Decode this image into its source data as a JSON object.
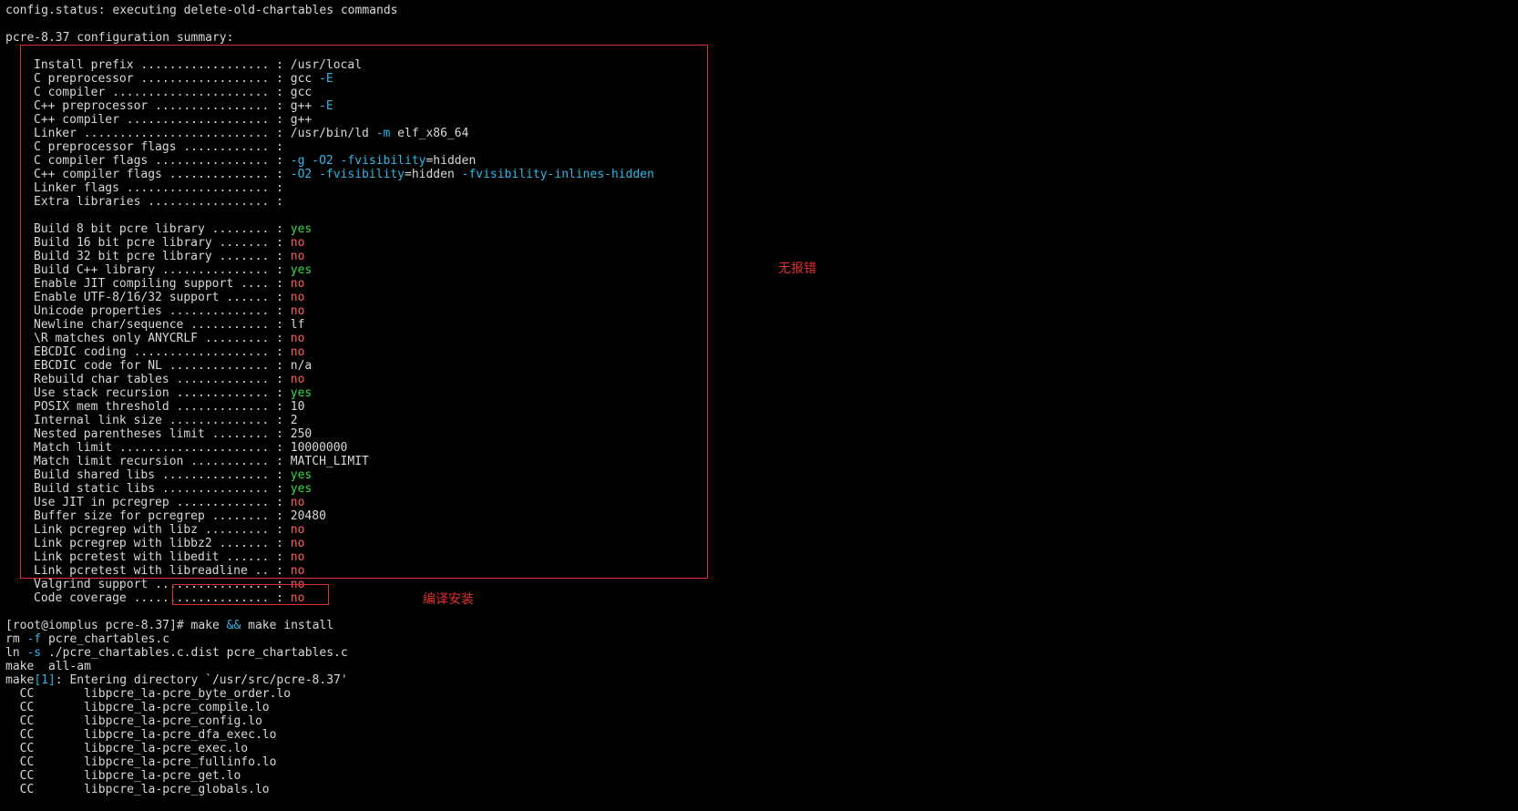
{
  "header": {
    "status_line": "config.status: executing delete-old-chartables commands",
    "summary_title": "pcre-8.37 configuration summary:"
  },
  "config": [
    {
      "label": "Install prefix ..................",
      "value": "/usr/local",
      "tone": "plain"
    },
    {
      "label": "C preprocessor ..................",
      "value": "gcc",
      "flag": "-E",
      "tone": "plain"
    },
    {
      "label": "C compiler ......................",
      "value": "gcc",
      "tone": "plain"
    },
    {
      "label": "C++ preprocessor ................",
      "value": "g++",
      "flag": "-E",
      "tone": "plain"
    },
    {
      "label": "C++ compiler ....................",
      "value": "g++",
      "tone": "plain"
    },
    {
      "label": "Linker ..........................",
      "value": "/usr/bin/ld",
      "flag": "-m",
      "rest": "elf_x86_64",
      "tone": "plain"
    },
    {
      "label": "C preprocessor flags ............",
      "value": "",
      "tone": "plain"
    },
    {
      "label": "C compiler flags ................",
      "value": "",
      "flag": "-g -O2 -fvisibility",
      "rest": "=hidden",
      "tone": "plain"
    },
    {
      "label": "C++ compiler flags ..............",
      "value": "",
      "flag": "-O2 -fvisibility",
      "rest": "=hidden",
      "flag2": "-fvisibility-inlines-hidden",
      "tone": "plain"
    },
    {
      "label": "Linker flags ....................",
      "value": "",
      "tone": "plain"
    },
    {
      "label": "Extra libraries .................",
      "value": "",
      "tone": "plain"
    },
    {
      "label": "",
      "value": "",
      "tone": "blank"
    },
    {
      "label": "Build 8 bit pcre library ........",
      "value": "yes",
      "tone": "green"
    },
    {
      "label": "Build 16 bit pcre library .......",
      "value": "no",
      "tone": "red"
    },
    {
      "label": "Build 32 bit pcre library .......",
      "value": "no",
      "tone": "red"
    },
    {
      "label": "Build C++ library ...............",
      "value": "yes",
      "tone": "green"
    },
    {
      "label": "Enable JIT compiling support ....",
      "value": "no",
      "tone": "red"
    },
    {
      "label": "Enable UTF-8/16/32 support ......",
      "value": "no",
      "tone": "red"
    },
    {
      "label": "Unicode properties ..............",
      "value": "no",
      "tone": "red"
    },
    {
      "label": "Newline char/sequence ...........",
      "value": "lf",
      "tone": "plain"
    },
    {
      "label": "\\R matches only ANYCRLF .........",
      "value": "no",
      "tone": "red"
    },
    {
      "label": "EBCDIC coding ...................",
      "value": "no",
      "tone": "red"
    },
    {
      "label": "EBCDIC code for NL ..............",
      "value": "n/a",
      "tone": "plain"
    },
    {
      "label": "Rebuild char tables .............",
      "value": "no",
      "tone": "red"
    },
    {
      "label": "Use stack recursion .............",
      "value": "yes",
      "tone": "green"
    },
    {
      "label": "POSIX mem threshold .............",
      "value": "10",
      "tone": "plain"
    },
    {
      "label": "Internal link size ..............",
      "value": "2",
      "tone": "plain"
    },
    {
      "label": "Nested parentheses limit ........",
      "value": "250",
      "tone": "plain"
    },
    {
      "label": "Match limit .....................",
      "value": "10000000",
      "tone": "plain"
    },
    {
      "label": "Match limit recursion ...........",
      "value": "MATCH_LIMIT",
      "tone": "plain"
    },
    {
      "label": "Build shared libs ...............",
      "value": "yes",
      "tone": "green"
    },
    {
      "label": "Build static libs ...............",
      "value": "yes",
      "tone": "green"
    },
    {
      "label": "Use JIT in pcregrep .............",
      "value": "no",
      "tone": "red"
    },
    {
      "label": "Buffer size for pcregrep ........",
      "value": "20480",
      "tone": "plain"
    },
    {
      "label": "Link pcregrep with libz .........",
      "value": "no",
      "tone": "red"
    },
    {
      "label": "Link pcregrep with libbz2 .......",
      "value": "no",
      "tone": "red"
    },
    {
      "label": "Link pcretest with libedit ......",
      "value": "no",
      "tone": "red"
    },
    {
      "label": "Link pcretest with libreadline ..",
      "value": "no",
      "tone": "red"
    },
    {
      "label": "Valgrind support ................",
      "value": "no",
      "tone": "red"
    },
    {
      "label": "Code coverage ...................",
      "value": "no",
      "tone": "red"
    }
  ],
  "prompt": {
    "ps1": "[root@iomplus pcre-8.37]#",
    "cmd_a": "make",
    "op": "&&",
    "cmd_b": "make install"
  },
  "output": {
    "rm_cmd": "rm",
    "rm_flag": "-f",
    "rm_arg": "pcre_chartables.c",
    "ln_cmd": "ln",
    "ln_flag": "-s",
    "ln_arg": "./pcre_chartables.c.dist pcre_chartables.c",
    "make_all": "make  all-am",
    "make1_a": "make",
    "make1_b": "[1]",
    "make1_c": ": Entering directory `/usr/src/pcre-8.37'"
  },
  "cc_lines": [
    {
      "tag": "CC",
      "file": "libpcre_la-pcre_byte_order.lo"
    },
    {
      "tag": "CC",
      "file": "libpcre_la-pcre_compile.lo"
    },
    {
      "tag": "CC",
      "file": "libpcre_la-pcre_config.lo"
    },
    {
      "tag": "CC",
      "file": "libpcre_la-pcre_dfa_exec.lo"
    },
    {
      "tag": "CC",
      "file": "libpcre_la-pcre_exec.lo"
    },
    {
      "tag": "CC",
      "file": "libpcre_la-pcre_fullinfo.lo"
    },
    {
      "tag": "CC",
      "file": "libpcre_la-pcre_get.lo"
    },
    {
      "tag": "CC",
      "file": "libpcre_la-pcre_globals.lo"
    }
  ],
  "annotations": {
    "no_error": "无报错",
    "compile_install": "编译安装"
  },
  "colors": {
    "background": "#000000",
    "text": "#d8d8d8",
    "flag": "#2fb8e8",
    "yes": "#36d94a",
    "no": "#ff5c5c",
    "annotation": "#e03030"
  }
}
